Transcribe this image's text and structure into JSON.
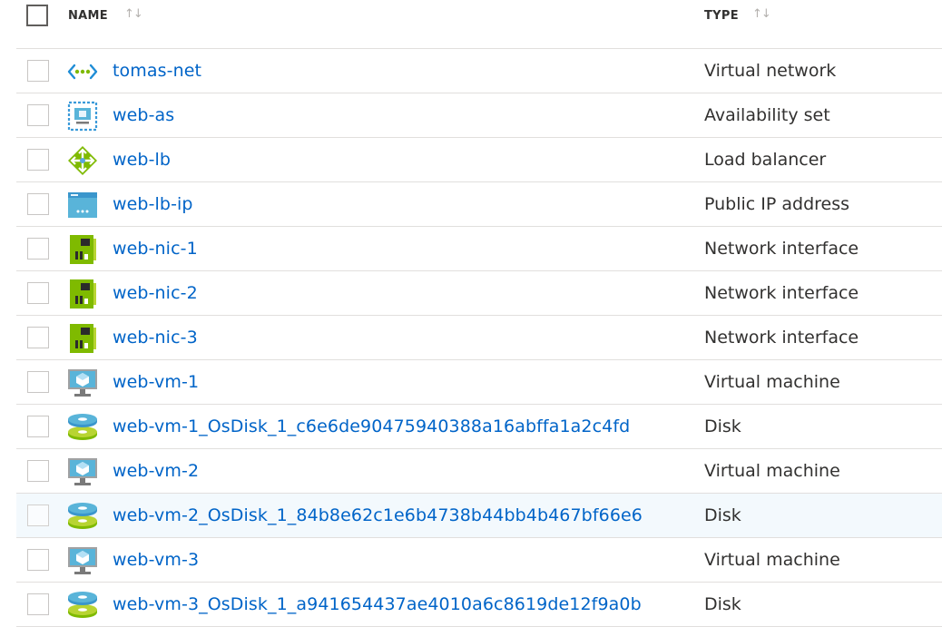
{
  "columns": {
    "name_label": "NAME",
    "type_label": "TYPE",
    "sort_glyph": "↑↓"
  },
  "rows": [
    {
      "name": "tomas-net",
      "type": "Virtual network",
      "icon": "virtual-network-icon"
    },
    {
      "name": "web-as",
      "type": "Availability set",
      "icon": "availability-set-icon"
    },
    {
      "name": "web-lb",
      "type": "Load balancer",
      "icon": "load-balancer-icon"
    },
    {
      "name": "web-lb-ip",
      "type": "Public IP address",
      "icon": "public-ip-icon"
    },
    {
      "name": "web-nic-1",
      "type": "Network interface",
      "icon": "network-interface-icon"
    },
    {
      "name": "web-nic-2",
      "type": "Network interface",
      "icon": "network-interface-icon"
    },
    {
      "name": "web-nic-3",
      "type": "Network interface",
      "icon": "network-interface-icon"
    },
    {
      "name": "web-vm-1",
      "type": "Virtual machine",
      "icon": "virtual-machine-icon"
    },
    {
      "name": "web-vm-1_OsDisk_1_c6e6de90475940388a16abffa1a2c4fd",
      "type": "Disk",
      "icon": "disk-icon"
    },
    {
      "name": "web-vm-2",
      "type": "Virtual machine",
      "icon": "virtual-machine-icon"
    },
    {
      "name": "web-vm-2_OsDisk_1_84b8e62c1e6b4738b44bb4b467bf66e6",
      "type": "Disk",
      "icon": "disk-icon"
    },
    {
      "name": "web-vm-3",
      "type": "Virtual machine",
      "icon": "virtual-machine-icon"
    },
    {
      "name": "web-vm-3_OsDisk_1_a941654437ae4010a6c8619de12f9a0b",
      "type": "Disk",
      "icon": "disk-icon"
    }
  ],
  "highlighted_row": 10,
  "colors": {
    "link": "#0064c8",
    "text": "#323130",
    "row_border": "#e1dfdd",
    "hover_row": "#f3f9fd"
  }
}
